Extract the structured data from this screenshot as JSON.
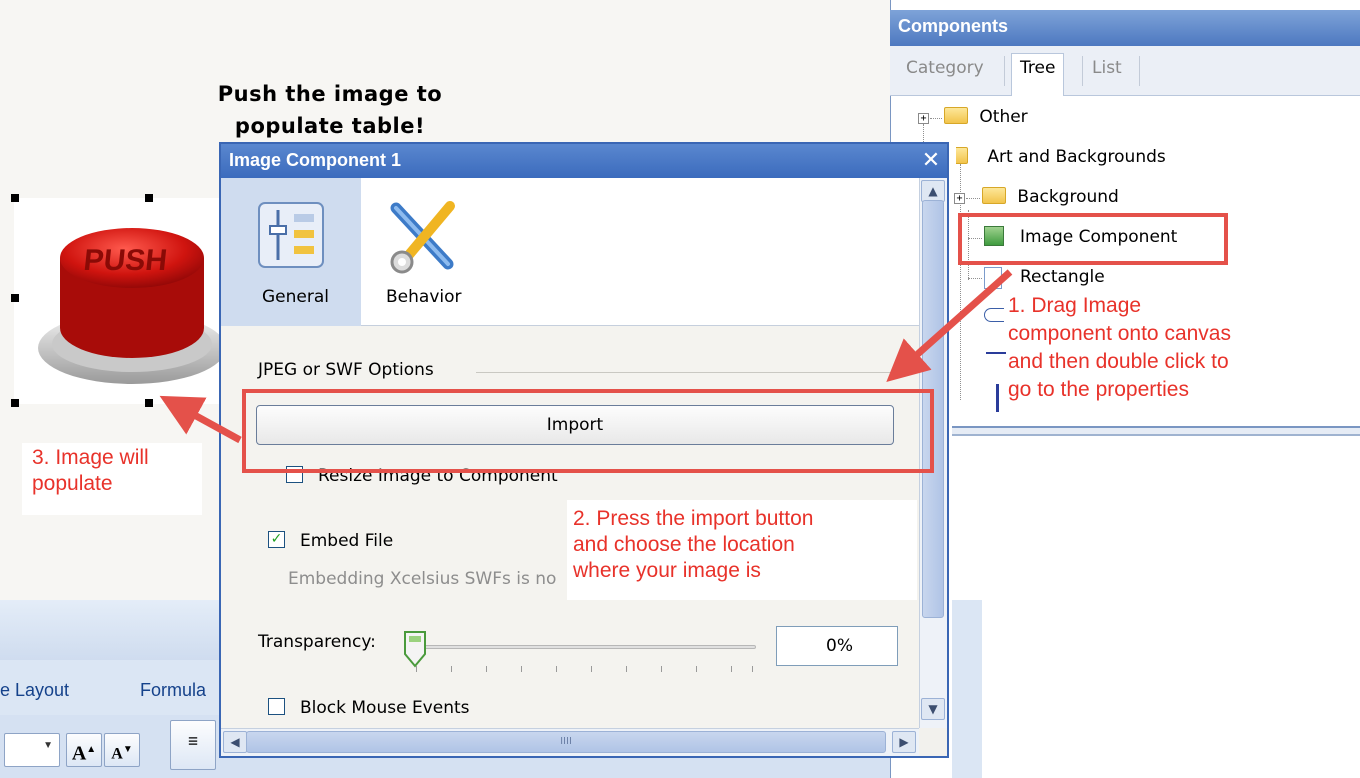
{
  "canvas": {
    "title_line1": "Push the image to",
    "title_line2": "populate table!",
    "push_image_text": "PUSH"
  },
  "annotations": {
    "step3_line1": "3. Image will",
    "step3_line2": "populate",
    "step1_line1": "1. Drag Image",
    "step1_line2": "component onto canvas",
    "step1_line3": "and then double click to",
    "step1_line4": "go to the properties",
    "step2_line1": "2. Press the import button",
    "step2_line2": "and choose the location",
    "step2_line3": "where your image is",
    "accent_color": "#e8322a"
  },
  "ribbon": {
    "tab_layout": "e Layout",
    "tab_formula": "Formula",
    "font_grow": "A",
    "font_shrink": "A"
  },
  "components_panel": {
    "title": "Components",
    "tabs": [
      "Category",
      "Tree",
      "List"
    ],
    "selected_tab": "Tree",
    "tree": {
      "other": "Other",
      "art_and_backgrounds": "Art and Backgrounds",
      "background": "Background",
      "image_component": "Image Component",
      "rectangle": "Rectangle"
    }
  },
  "dialog": {
    "title": "Image Component 1",
    "toolbar": {
      "general": "General",
      "behavior": "Behavior",
      "selected": "General"
    },
    "section_title": "JPEG or SWF Options",
    "import_button": "Import",
    "resize_checkbox": {
      "label": "Resize Image to Component",
      "checked": false
    },
    "embed_checkbox": {
      "label": "Embed File",
      "checked": true
    },
    "embed_note": "Embedding Xcelsius SWFs is no",
    "transparency_label": "Transparency:",
    "transparency_value": "0%",
    "block_mouse_checkbox": {
      "label": "Block Mouse Events",
      "checked": false
    },
    "scroll_grip": "IIII"
  }
}
